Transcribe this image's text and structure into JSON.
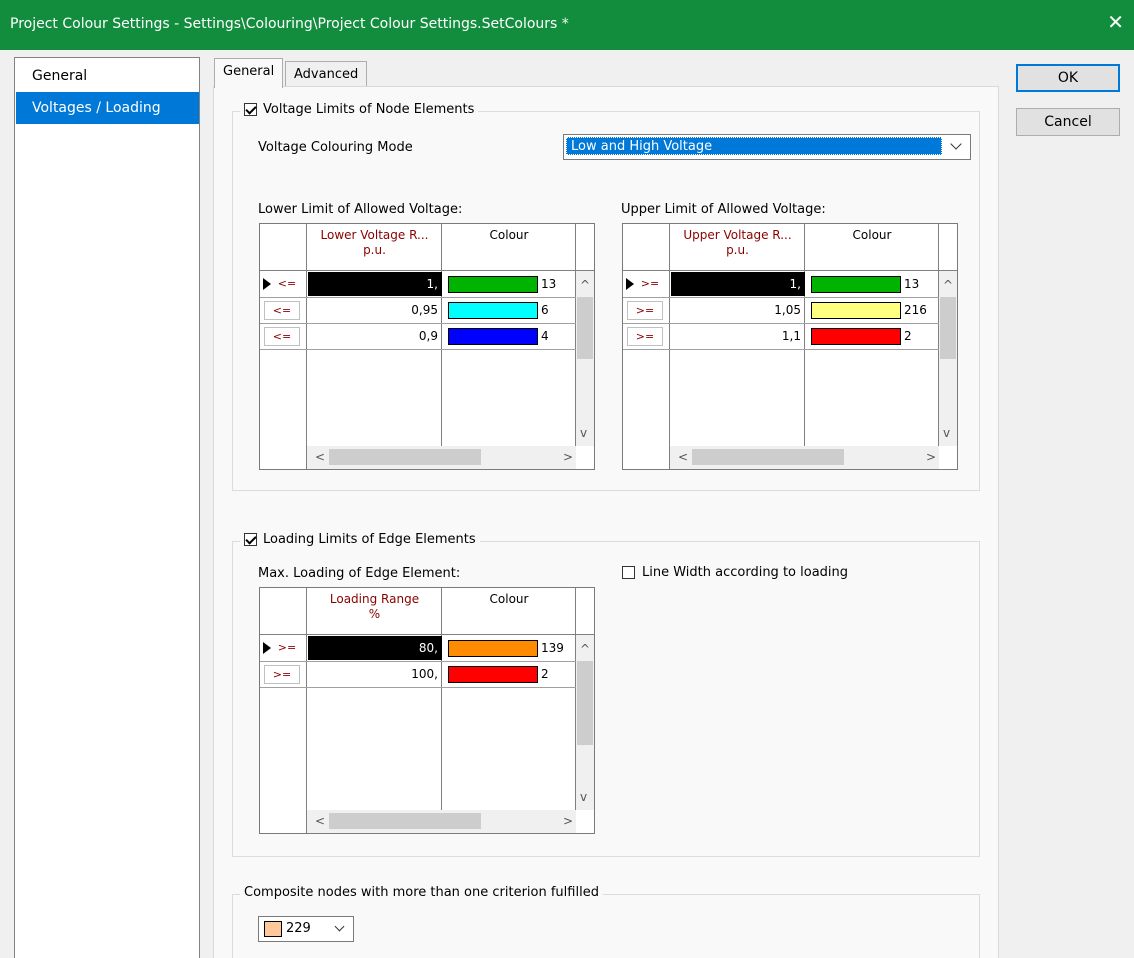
{
  "window": {
    "title": "Project Colour Settings - Settings\\Colouring\\Project Colour Settings.SetColours *",
    "close_glyph": "✕",
    "accent_color": "#118d3d"
  },
  "nav": {
    "items": [
      "General",
      "Voltages / Loading"
    ]
  },
  "tabs": [
    "General",
    "Advanced"
  ],
  "buttons": {
    "ok": "OK",
    "cancel": "Cancel"
  },
  "voltage_group": {
    "legend": "Voltage Limits of Node Elements",
    "checked": true,
    "mode_label": "Voltage Colouring Mode",
    "mode_value": "Low and High Voltage",
    "lower": {
      "title": "Lower Limit of Allowed Voltage:",
      "col_range": "Lower Voltage R...",
      "col_unit": "p.u.",
      "col_colour": "Colour",
      "rows": [
        {
          "op": "<=",
          "value": "1,",
          "color": "#00b300",
          "index": "13"
        },
        {
          "op": "<=",
          "value": "0,95",
          "color": "#00ffff",
          "index": "6"
        },
        {
          "op": "<=",
          "value": "0,9",
          "color": "#0000ff",
          "index": "4"
        }
      ]
    },
    "upper": {
      "title": "Upper Limit of Allowed Voltage:",
      "col_range": "Upper Voltage R...",
      "col_unit": "p.u.",
      "col_colour": "Colour",
      "rows": [
        {
          "op": ">=",
          "value": "1,",
          "color": "#00b300",
          "index": "13"
        },
        {
          "op": ">=",
          "value": "1,05",
          "color": "#ffff80",
          "index": "216"
        },
        {
          "op": ">=",
          "value": "1,1",
          "color": "#ff0000",
          "index": "2"
        }
      ]
    }
  },
  "loading_group": {
    "legend": "Loading Limits of Edge Elements",
    "checked": true,
    "grid_title": "Max. Loading of Edge Element:",
    "col_range": "Loading Range",
    "col_unit": "%",
    "col_colour": "Colour",
    "rows": [
      {
        "op": ">=",
        "value": "80,",
        "color": "#ff8c00",
        "index": "139"
      },
      {
        "op": ">=",
        "value": "100,",
        "color": "#ff0000",
        "index": "2"
      }
    ],
    "line_width_label": "Line Width according to loading",
    "line_width_checked": false
  },
  "composite_group": {
    "legend": "Composite nodes with more than one criterion fulfilled",
    "color": "#ffc89b",
    "index": "229"
  }
}
